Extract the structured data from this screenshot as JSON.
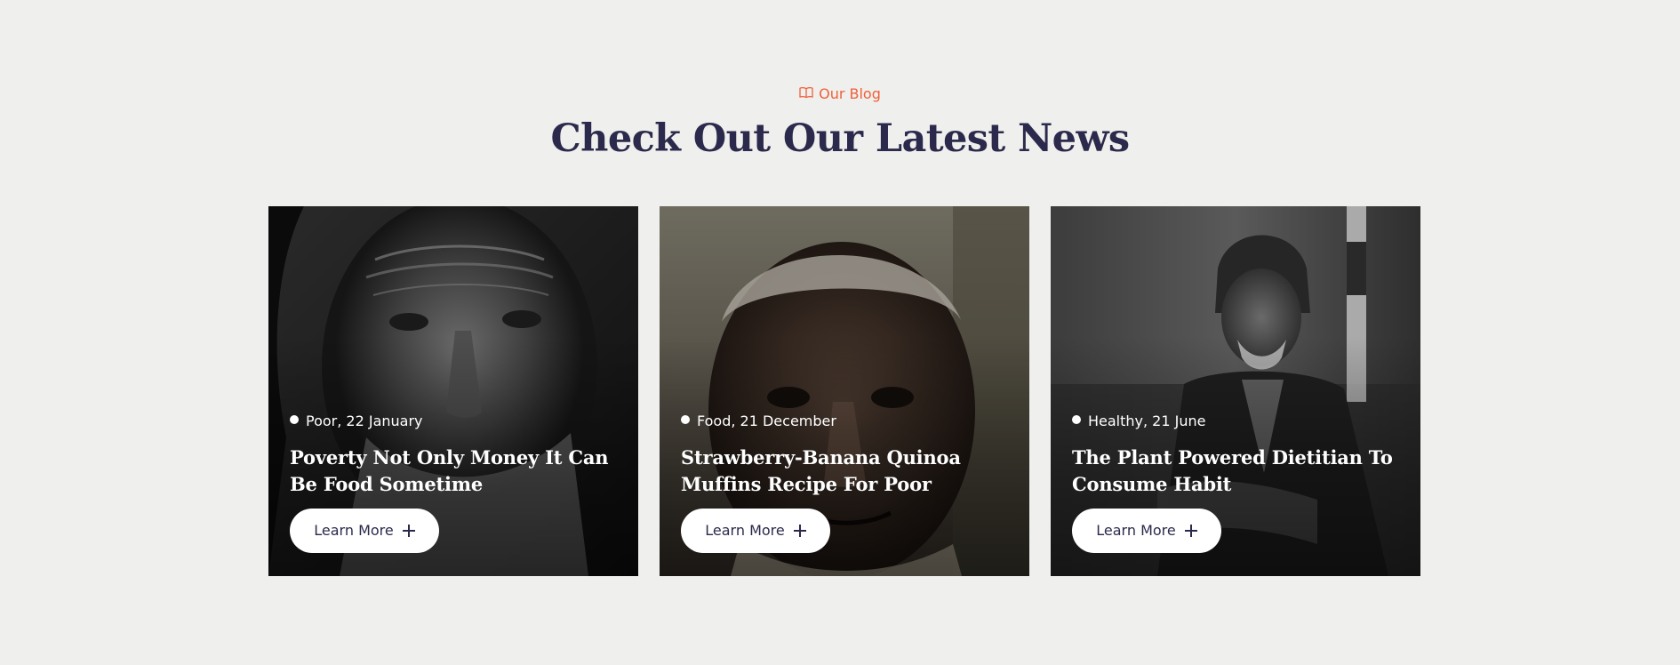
{
  "section": {
    "eyebrow": "Our Blog",
    "title": "Check Out Our Latest News"
  },
  "icons": {
    "eyebrow_icon": "open-book-icon",
    "button_icon": "plus-icon",
    "meta_icon": "dot-icon"
  },
  "colors": {
    "accent": "#f0603a",
    "heading": "#2b2a4c",
    "background": "#efefed",
    "button_bg": "#ffffff"
  },
  "posts": [
    {
      "meta": "Poor, 22 January",
      "title": "Poverty Not Only Money It Can Be Food Sometime",
      "button_label": "Learn More",
      "image": "elderly-man-bw-portrait"
    },
    {
      "meta": "Food, 21 December",
      "title": "Strawberry-Banana Quinoa Muffins Recipe For Poor",
      "button_label": "Learn More",
      "image": "elderly-man-warm-portrait"
    },
    {
      "meta": "Healthy, 21 June",
      "title": "The Plant Powered Dietitian To Consume Habit",
      "button_label": "Learn More",
      "image": "elderly-man-seated-hat"
    }
  ]
}
